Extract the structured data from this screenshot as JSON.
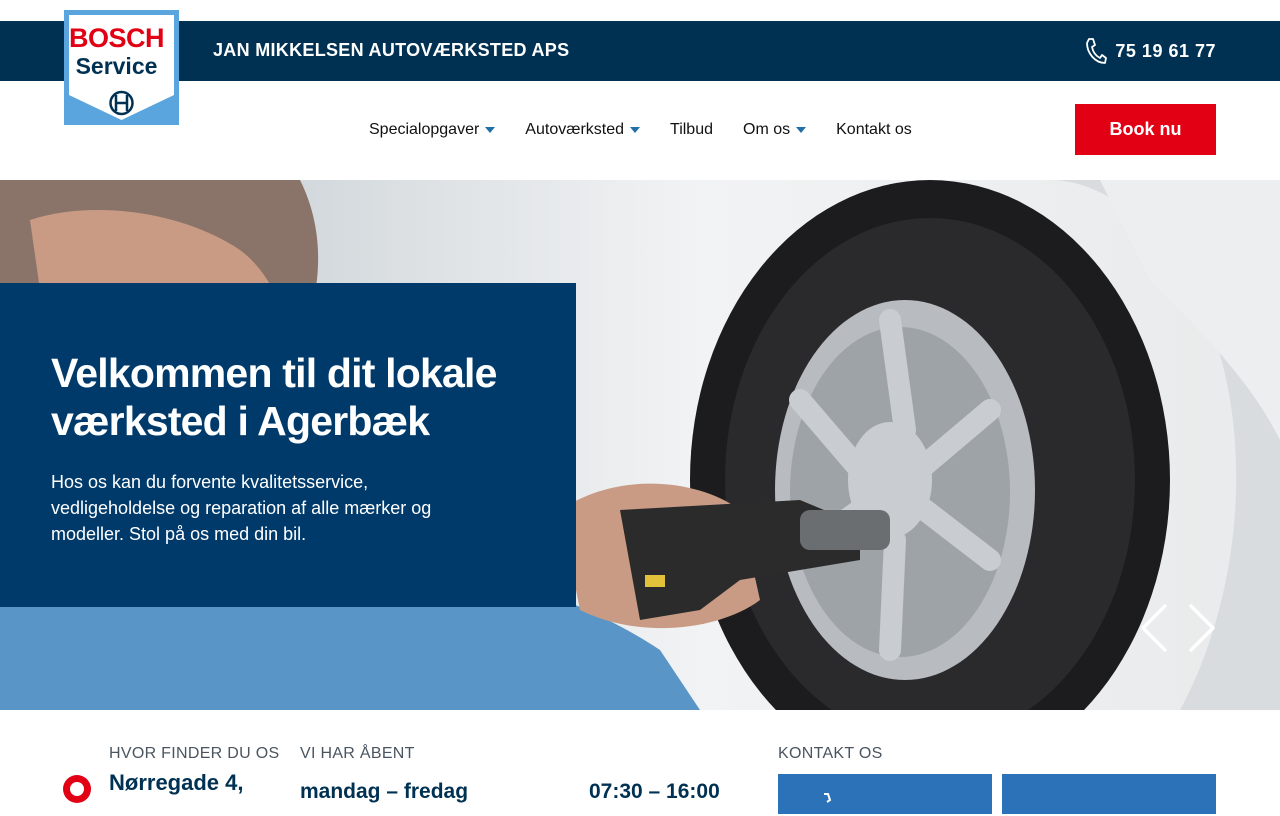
{
  "header": {
    "company_name": "JAN MIKKELSEN AUTOVÆRKSTED APS",
    "phone": "75 19 61 77",
    "logo": {
      "brand": "BOSCH",
      "sub": "Service"
    }
  },
  "nav": {
    "items": [
      {
        "label": "Specialopgaver",
        "has_dropdown": true
      },
      {
        "label": "Autoværksted",
        "has_dropdown": true
      },
      {
        "label": "Tilbud",
        "has_dropdown": false
      },
      {
        "label": "Om os",
        "has_dropdown": true
      },
      {
        "label": "Kontakt os",
        "has_dropdown": false
      }
    ],
    "cta_label": "Book nu"
  },
  "hero": {
    "title": "Velkommen til dit lokale værksted i Agerbæk",
    "text": "Hos os kan du forvente kvalitetsservice, vedligeholdelse og reparation af alle mærker og modeller. Stol på os med din bil."
  },
  "info": {
    "location_label": "HVOR FINDER DU OS",
    "address": "Nørregade 4,",
    "hours_label": "VI HAR ÅBENT",
    "days": "mandag – fredag",
    "hours": "07:30 – 16:00",
    "contact_label": "KONTAKT OS"
  },
  "colors": {
    "navy": "#003153",
    "hero_box": "#003a6b",
    "accent_red": "#e20015",
    "tile_blue": "#2c72b8"
  }
}
